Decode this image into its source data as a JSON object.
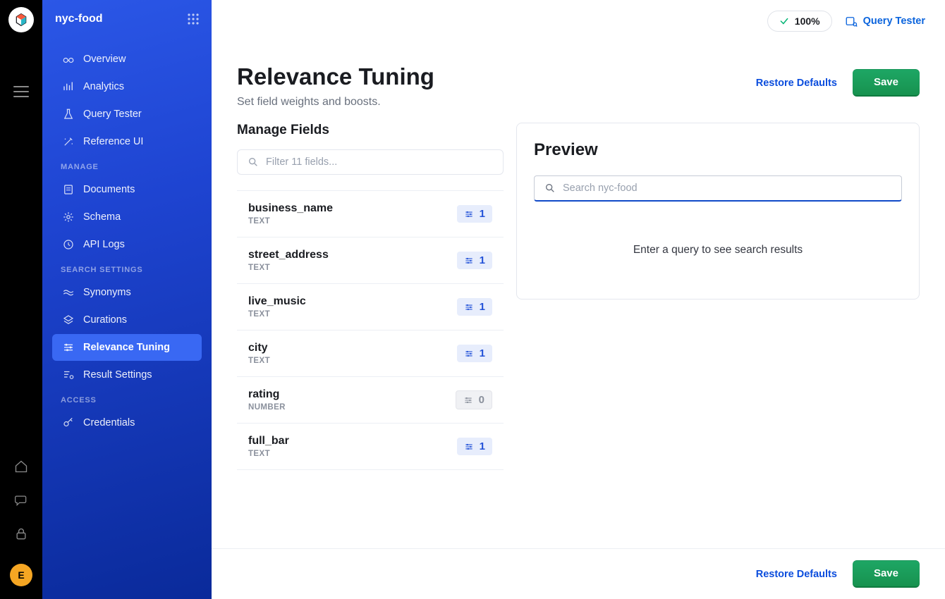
{
  "rail": {
    "avatar_initial": "E"
  },
  "sidebar": {
    "engine_name": "nyc-food",
    "groups": [
      {
        "label": null,
        "items": [
          {
            "id": "overview",
            "label": "Overview"
          },
          {
            "id": "analytics",
            "label": "Analytics"
          },
          {
            "id": "query-tester",
            "label": "Query Tester"
          },
          {
            "id": "reference-ui",
            "label": "Reference UI"
          }
        ]
      },
      {
        "label": "MANAGE",
        "items": [
          {
            "id": "documents",
            "label": "Documents"
          },
          {
            "id": "schema",
            "label": "Schema"
          },
          {
            "id": "api-logs",
            "label": "API Logs"
          }
        ]
      },
      {
        "label": "SEARCH SETTINGS",
        "items": [
          {
            "id": "synonyms",
            "label": "Synonyms"
          },
          {
            "id": "curations",
            "label": "Curations"
          },
          {
            "id": "relevance-tuning",
            "label": "Relevance Tuning",
            "active": true
          },
          {
            "id": "result-settings",
            "label": "Result Settings"
          }
        ]
      },
      {
        "label": "ACCESS",
        "items": [
          {
            "id": "credentials",
            "label": "Credentials"
          }
        ]
      }
    ]
  },
  "topbar": {
    "progress": "100%",
    "query_tester_label": "Query Tester"
  },
  "page": {
    "title": "Relevance Tuning",
    "subtitle": "Set field weights and boosts.",
    "restore_label": "Restore Defaults",
    "save_label": "Save"
  },
  "manage_fields": {
    "heading": "Manage Fields",
    "filter_placeholder": "Filter 11 fields...",
    "rows": [
      {
        "name": "business_name",
        "type": "TEXT",
        "weight": "1",
        "enabled": true
      },
      {
        "name": "street_address",
        "type": "TEXT",
        "weight": "1",
        "enabled": true
      },
      {
        "name": "live_music",
        "type": "TEXT",
        "weight": "1",
        "enabled": true
      },
      {
        "name": "city",
        "type": "TEXT",
        "weight": "1",
        "enabled": true
      },
      {
        "name": "rating",
        "type": "NUMBER",
        "weight": "0",
        "enabled": false
      },
      {
        "name": "full_bar",
        "type": "TEXT",
        "weight": "1",
        "enabled": true
      }
    ]
  },
  "preview": {
    "heading": "Preview",
    "search_placeholder": "Search nyc-food",
    "empty_text": "Enter a query to see search results"
  },
  "footer": {
    "restore_label": "Restore Defaults",
    "save_label": "Save"
  }
}
